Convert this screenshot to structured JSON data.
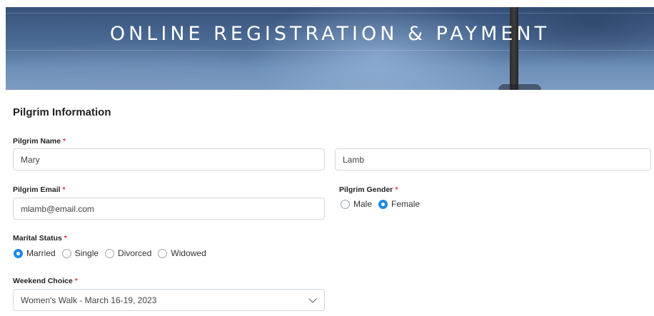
{
  "header": {
    "title": "ONLINE REGISTRATION & PAYMENT"
  },
  "form": {
    "section_title": "Pilgrim Information",
    "required_mark": "*",
    "name": {
      "label": "Pilgrim Name",
      "first": "Mary",
      "last": "Lamb"
    },
    "email": {
      "label": "Pilgrim Email",
      "value": "mlamb@email.com"
    },
    "gender": {
      "label": "Pilgrim Gender",
      "options": [
        "Male",
        "Female"
      ],
      "selected": "Female"
    },
    "marital": {
      "label": "Marital Status",
      "options": [
        "Married",
        "Single",
        "Divorced",
        "Widowed"
      ],
      "selected": "Married"
    },
    "weekend": {
      "label": "Weekend Choice",
      "value": "Women's Walk - March 16-19, 2023"
    }
  },
  "colors": {
    "accent": "#1e88e5",
    "required": "#d9353b"
  }
}
